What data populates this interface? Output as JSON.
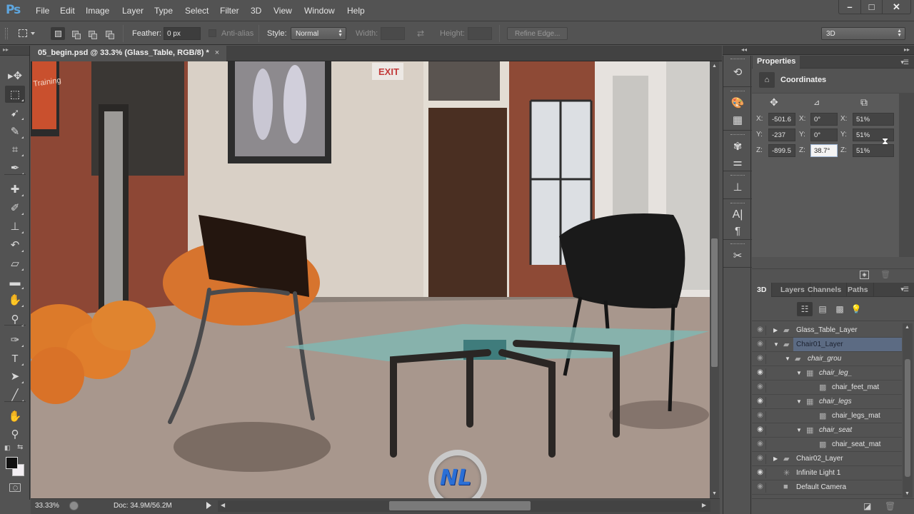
{
  "app": {
    "logo": "Ps",
    "menu": [
      "File",
      "Edit",
      "Image",
      "Layer",
      "Type",
      "Select",
      "Filter",
      "3D",
      "View",
      "Window",
      "Help"
    ],
    "window_controls": {
      "minimize": "–",
      "maximize": "□",
      "close": "✕"
    }
  },
  "options_bar": {
    "feather_label": "Feather:",
    "feather_value": "0 px",
    "antialias_label": "Anti-alias",
    "style_label": "Style:",
    "style_value": "Normal",
    "width_label": "Width:",
    "width_value": "",
    "height_label": "Height:",
    "height_value": "",
    "refine_edge_label": "Refine Edge...",
    "workspace_value": "3D"
  },
  "document": {
    "tab_title": "05_begin.psd @ 33.3% (Glass_Table, RGB/8) *",
    "close_glyph": "×",
    "exit_sign": "EXIT",
    "poster_text": "Training",
    "watermark_text": "NL"
  },
  "status_bar": {
    "zoom": "33.33%",
    "doc_info": "Doc: 34.9M/56.2M"
  },
  "tools": [
    {
      "name": "move-tool",
      "glyph": "▸✥"
    },
    {
      "name": "rectangular-marquee-tool",
      "glyph": "⬚",
      "active": true
    },
    {
      "name": "lasso-tool",
      "glyph": "➹"
    },
    {
      "name": "quick-selection-tool",
      "glyph": "✎"
    },
    {
      "name": "crop-tool",
      "glyph": "⌗"
    },
    {
      "name": "eyedropper-tool",
      "glyph": "✒"
    },
    {
      "name": "spot-healing-brush-tool",
      "glyph": "✚"
    },
    {
      "name": "brush-tool",
      "glyph": "✐"
    },
    {
      "name": "clone-stamp-tool",
      "glyph": "⊥"
    },
    {
      "name": "history-brush-tool",
      "glyph": "↶"
    },
    {
      "name": "eraser-tool",
      "glyph": "▱"
    },
    {
      "name": "gradient-tool",
      "glyph": "▬"
    },
    {
      "name": "blur-tool",
      "glyph": "✋"
    },
    {
      "name": "dodge-tool",
      "glyph": "⚲"
    },
    {
      "name": "pen-tool",
      "glyph": "✑"
    },
    {
      "name": "type-tool",
      "glyph": "T"
    },
    {
      "name": "path-selection-tool",
      "glyph": "➤"
    },
    {
      "name": "line-tool",
      "glyph": "╱"
    },
    {
      "name": "hand-tool",
      "glyph": "✋"
    },
    {
      "name": "zoom-tool",
      "glyph": "⚲"
    }
  ],
  "properties_panel": {
    "tab_label": "Properties",
    "section_title": "Coordinates",
    "columns": [
      "move",
      "rotate",
      "scale"
    ],
    "rows": [
      {
        "axis": "X:",
        "position": "-501.6",
        "rotation": "0°",
        "scale": "51%"
      },
      {
        "axis": "Y:",
        "position": "-237",
        "rotation": "0°",
        "scale": "51%"
      },
      {
        "axis": "Z:",
        "position": "-899.5",
        "rotation": "38.7°",
        "scale": "51%"
      }
    ]
  },
  "layers_panel": {
    "tabs": [
      "3D",
      "Layers",
      "Channels",
      "Paths"
    ],
    "active_tab": "3D",
    "scene_items": [
      {
        "label": "Glass_Table_Layer",
        "level": 0,
        "type": "folder",
        "expanded": false,
        "visible_eye": false,
        "italic": false,
        "selected": false
      },
      {
        "label": "Chair01_Layer",
        "level": 0,
        "type": "folder",
        "expanded": true,
        "visible_eye": false,
        "italic": false,
        "selected": true
      },
      {
        "label": "chair_grou",
        "level": 1,
        "type": "folder",
        "expanded": true,
        "visible_eye": false,
        "italic": true,
        "selected": false
      },
      {
        "label": "chair_leg_",
        "level": 2,
        "type": "mesh",
        "expanded": true,
        "visible_eye": true,
        "italic": true,
        "selected": false
      },
      {
        "label": "chair_feet_mat",
        "level": 3,
        "type": "material",
        "expanded": null,
        "visible_eye": false,
        "italic": false,
        "selected": false
      },
      {
        "label": "chair_legs",
        "level": 2,
        "type": "mesh",
        "expanded": true,
        "visible_eye": true,
        "italic": true,
        "selected": false
      },
      {
        "label": "chair_legs_mat",
        "level": 3,
        "type": "material",
        "expanded": null,
        "visible_eye": false,
        "italic": false,
        "selected": false
      },
      {
        "label": "chair_seat",
        "level": 2,
        "type": "mesh",
        "expanded": true,
        "visible_eye": true,
        "italic": true,
        "selected": false
      },
      {
        "label": "chair_seat_mat",
        "level": 3,
        "type": "material",
        "expanded": null,
        "visible_eye": false,
        "italic": false,
        "selected": false
      },
      {
        "label": "Chair02_Layer",
        "level": 0,
        "type": "folder",
        "expanded": false,
        "visible_eye": false,
        "italic": false,
        "selected": false
      },
      {
        "label": "Infinite Light 1",
        "level": 0,
        "type": "light",
        "expanded": null,
        "visible_eye": true,
        "italic": false,
        "selected": false
      },
      {
        "label": "Default Camera",
        "level": 0,
        "type": "camera",
        "expanded": null,
        "visible_eye": false,
        "italic": false,
        "selected": false
      }
    ]
  },
  "colors": {
    "ui_bg": "#535353",
    "ps_blue": "#5ea7e0",
    "selection_blue": "#5c6b83",
    "foreground_color": "#111111",
    "background_color": "#f2eef2"
  }
}
